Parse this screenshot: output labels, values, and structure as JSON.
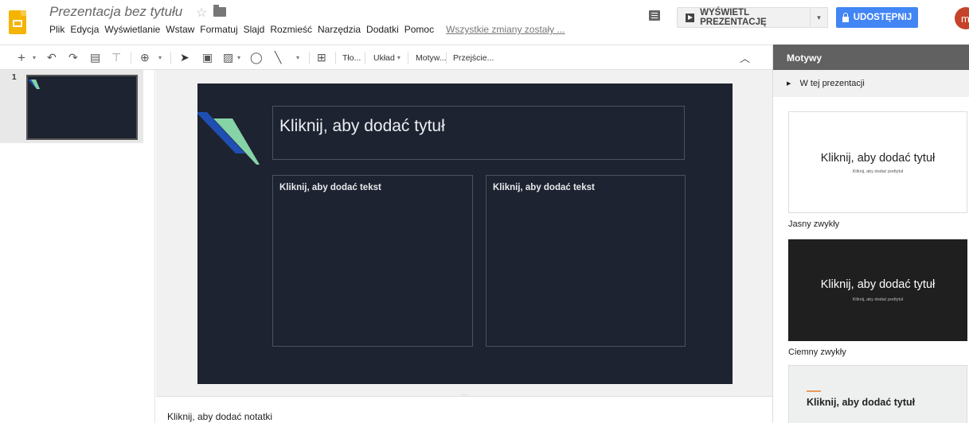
{
  "header": {
    "doc_title": "Prezentacja bez tytułu",
    "menu": [
      "Plik",
      "Edycja",
      "Wyświetlanie",
      "Wstaw",
      "Formatuj",
      "Slajd",
      "Rozmieść",
      "Narzędzia",
      "Dodatki",
      "Pomoc"
    ],
    "saved_status": "Wszystkie zmiany zostały ...",
    "present_label": "WYŚWIETL PREZENTACJĘ",
    "share_label": "UDOSTĘPNIJ",
    "avatar_letter": "m",
    "colors": {
      "share": "#4285f4",
      "logo": "#f4b400",
      "avatar": "#c5432a"
    }
  },
  "toolbar": {
    "background_label": "Tło...",
    "layout_label": "Układ",
    "theme_label": "Motyw...",
    "transition_label": "Przejście..."
  },
  "filmstrip": {
    "slides": [
      {
        "number": "1"
      }
    ]
  },
  "slide": {
    "title_placeholder": "Kliknij, aby dodać tytuł",
    "left_text_placeholder": "Kliknij, aby dodać tekst",
    "right_text_placeholder": "Kliknij, aby dodać tekst",
    "colors": {
      "background": "#1d2330",
      "accent_blue": "#1f4fb2",
      "accent_green": "#86d3a7"
    }
  },
  "notes": {
    "placeholder": "Kliknij, aby dodać notatki"
  },
  "themes_panel": {
    "title": "Motywy",
    "section_label": "W tej prezentacji",
    "themes": [
      {
        "preview_title": "Kliknij, aby dodać tytuł",
        "preview_subtitle": "Kliknij, aby dodać podtytuł",
        "name": "Jasny zwykły"
      },
      {
        "preview_title": "Kliknij, aby dodać tytuł",
        "preview_subtitle": "Kliknij, aby dodać podtytuł",
        "name": "Ciemny zwykły"
      },
      {
        "preview_title": "Kliknij, aby dodać tytuł"
      }
    ]
  }
}
